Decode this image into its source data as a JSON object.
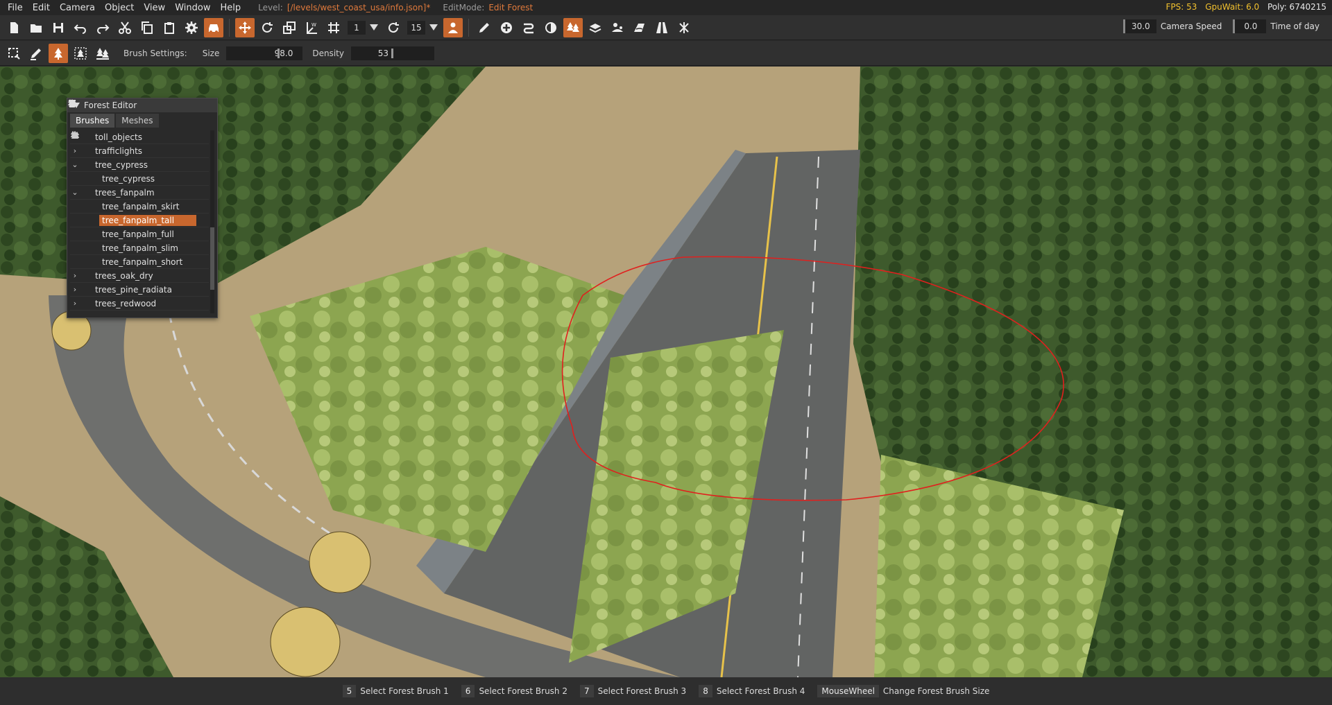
{
  "menu": [
    "File",
    "Edit",
    "Camera",
    "Object",
    "View",
    "Window",
    "Help"
  ],
  "level": {
    "label": "Level:",
    "value": "[/levels/west_coast_usa/info.json]*"
  },
  "editmode": {
    "label": "EditMode:",
    "value": "Edit Forest"
  },
  "stats": {
    "fps": "FPS: 53",
    "gpuwait": "GpuWait: 6.0",
    "poly": "Poly: 6740215"
  },
  "toolbar": {
    "rotation_snap": "1",
    "scale_snap": "15",
    "camera_speed_value": "30.0",
    "camera_speed_label": "Camera Speed",
    "time_of_day_value": "0.0",
    "time_of_day_label": "Time of day"
  },
  "brush": {
    "settings_label": "Brush Settings:",
    "size_label": "Size",
    "size_value": "98.0",
    "density_label": "Density",
    "density_value": "53"
  },
  "panel": {
    "title": "Forest Editor",
    "tabs": [
      "Brushes",
      "Meshes"
    ],
    "items": [
      {
        "label": "toll_objects",
        "level": 0,
        "expanded": false
      },
      {
        "label": "trafficlights",
        "level": 0,
        "expanded": false
      },
      {
        "label": "tree_cypress",
        "level": 0,
        "expanded": true
      },
      {
        "label": "tree_cypress",
        "level": 1
      },
      {
        "label": "trees_fanpalm",
        "level": 0,
        "expanded": true
      },
      {
        "label": "tree_fanpalm_skirt",
        "level": 1
      },
      {
        "label": "tree_fanpalm_tall",
        "level": 1,
        "selected": true
      },
      {
        "label": "tree_fanpalm_full",
        "level": 1
      },
      {
        "label": "tree_fanpalm_slim",
        "level": 1
      },
      {
        "label": "tree_fanpalm_short",
        "level": 1
      },
      {
        "label": "trees_oak_dry",
        "level": 0,
        "expanded": false
      },
      {
        "label": "trees_pine_radiata",
        "level": 0,
        "expanded": false
      },
      {
        "label": "trees_redwood",
        "level": 0,
        "expanded": false
      }
    ]
  },
  "hotkeys": [
    {
      "key": "5",
      "action": "Select Forest Brush 1"
    },
    {
      "key": "6",
      "action": "Select Forest Brush 2"
    },
    {
      "key": "7",
      "action": "Select Forest Brush 3"
    },
    {
      "key": "8",
      "action": "Select Forest Brush 4"
    },
    {
      "key": "MouseWheel",
      "action": "Change Forest Brush Size"
    }
  ],
  "colors": {
    "accent": "#c8672e",
    "fps": "#f2c12e",
    "level_value": "#e07a3c",
    "brush_outline": "#e0201e"
  }
}
